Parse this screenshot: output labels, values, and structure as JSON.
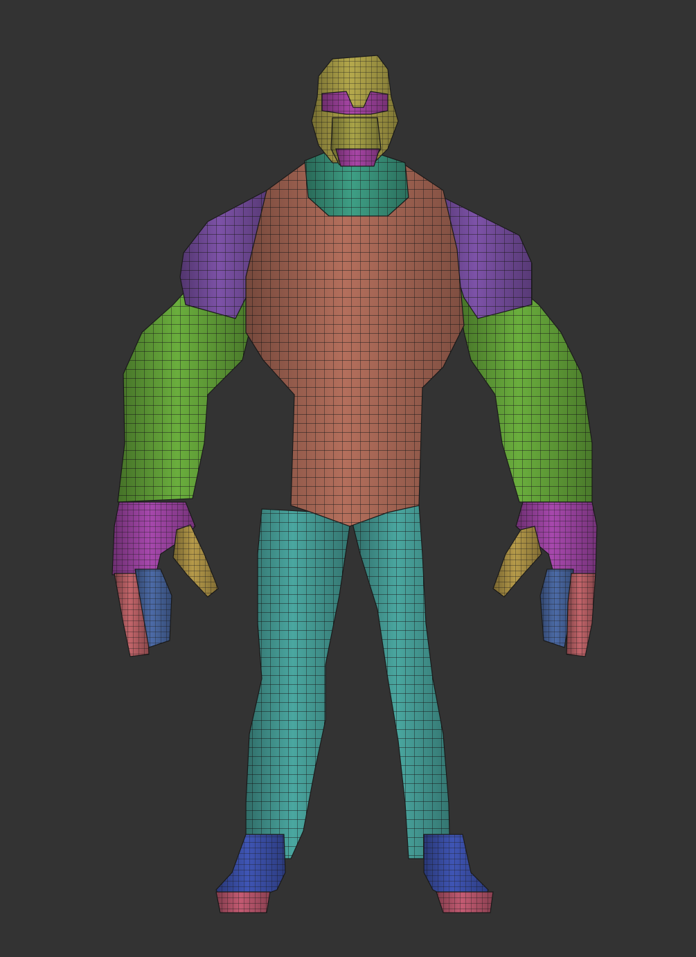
{
  "viewport": {
    "background": "#333333"
  },
  "model": {
    "wire_color": "#1d1d1d",
    "polygroups": {
      "head": "#b5a94c",
      "face_mask": "#a946a7",
      "face_lower": "#a9a448",
      "neck": "#3e9f85",
      "torso": "#b46f5c",
      "shoulder_left": "#7d52a8",
      "shoulder_right": "#7d52a8",
      "arm_left": "#6aae3d",
      "arm_right": "#6aae3d",
      "hand_left": "#a748ad",
      "hand_right": "#a748ad",
      "thumb_left": "#b79b4a",
      "thumb_right": "#b79b4a",
      "fingers_blue": "#4c6ba7",
      "fingers_pink": "#c2656a",
      "leg_left": "#4aa7a0",
      "leg_right": "#4aa7a0",
      "foot_left": "#3f55b5",
      "foot_right": "#3f55b5",
      "toes": "#c45b73"
    }
  }
}
